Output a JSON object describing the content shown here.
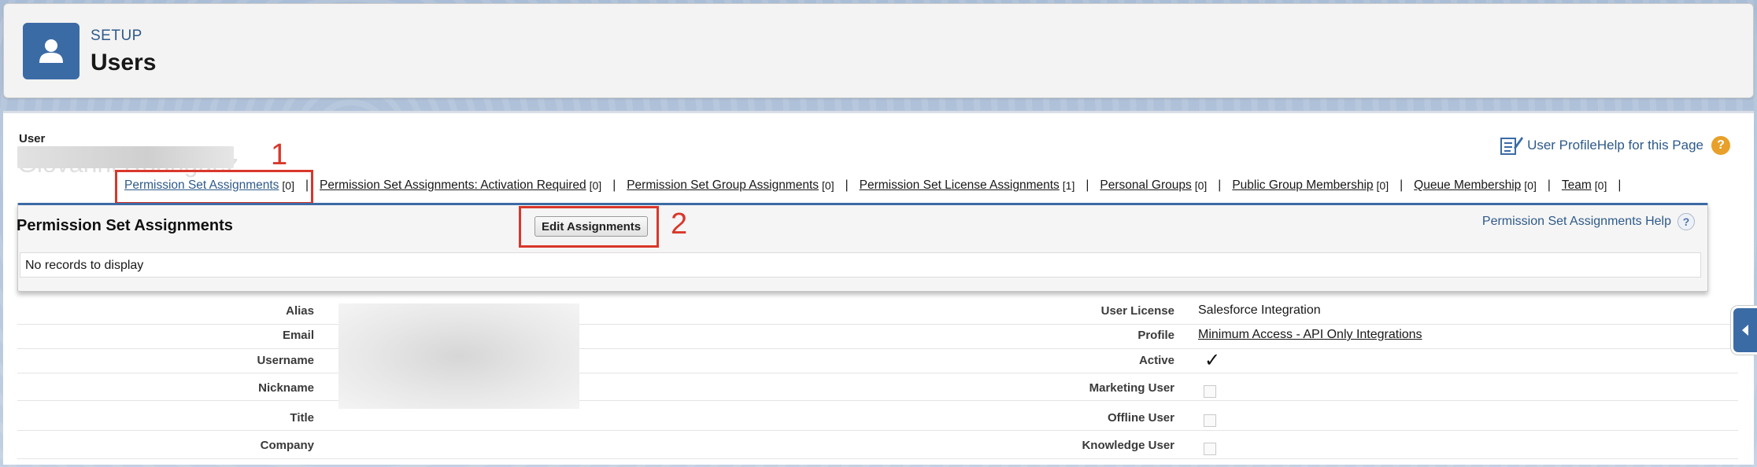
{
  "header": {
    "setup_label": "SETUP",
    "title": "Users",
    "icon": "user-icon"
  },
  "user": {
    "label": "User",
    "name_obscured": "Giovanni Rodriguez"
  },
  "page_help": {
    "text": "User ProfileHelp for this Page",
    "icon": "help-question-icon"
  },
  "related_links": [
    {
      "label": "Permission Set Assignments",
      "count": "[0]"
    },
    {
      "label": "Permission Set Assignments: Activation Required",
      "count": "[0]"
    },
    {
      "label": "Permission Set Group Assignments",
      "count": "[0]"
    },
    {
      "label": "Permission Set License Assignments",
      "count": "[1]"
    },
    {
      "label": "Personal Groups",
      "count": "[0]"
    },
    {
      "label": "Public Group Membership",
      "count": "[0]"
    },
    {
      "label": "Queue Membership",
      "count": "[0]"
    },
    {
      "label": "Team",
      "count": "[0]"
    }
  ],
  "separator": "|",
  "annotations": {
    "one": "1",
    "two": "2"
  },
  "overlay": {
    "title": "Permission Set Assignments",
    "edit_button": "Edit Assignments",
    "help_text": "Permission Set Assignments Help",
    "help_icon": "?",
    "empty_text": "No records to display"
  },
  "details_left": [
    {
      "label": "Alias"
    },
    {
      "label": "Email"
    },
    {
      "label": "Username"
    },
    {
      "label": "Nickname"
    },
    {
      "label": "Title"
    },
    {
      "label": "Company"
    }
  ],
  "details_right": [
    {
      "label": "User License",
      "value": "Salesforce Integration"
    },
    {
      "label": "Profile",
      "value": "Minimum Access - API Only Integrations"
    },
    {
      "label": "Active",
      "checked": true
    },
    {
      "label": "Marketing User",
      "checked": false
    },
    {
      "label": "Offline User",
      "checked": false
    },
    {
      "label": "Knowledge User",
      "checked": false
    }
  ],
  "colors": {
    "accent": "#3b6ba5",
    "annotation": "#d9372b",
    "link": "#2e5a8a"
  }
}
